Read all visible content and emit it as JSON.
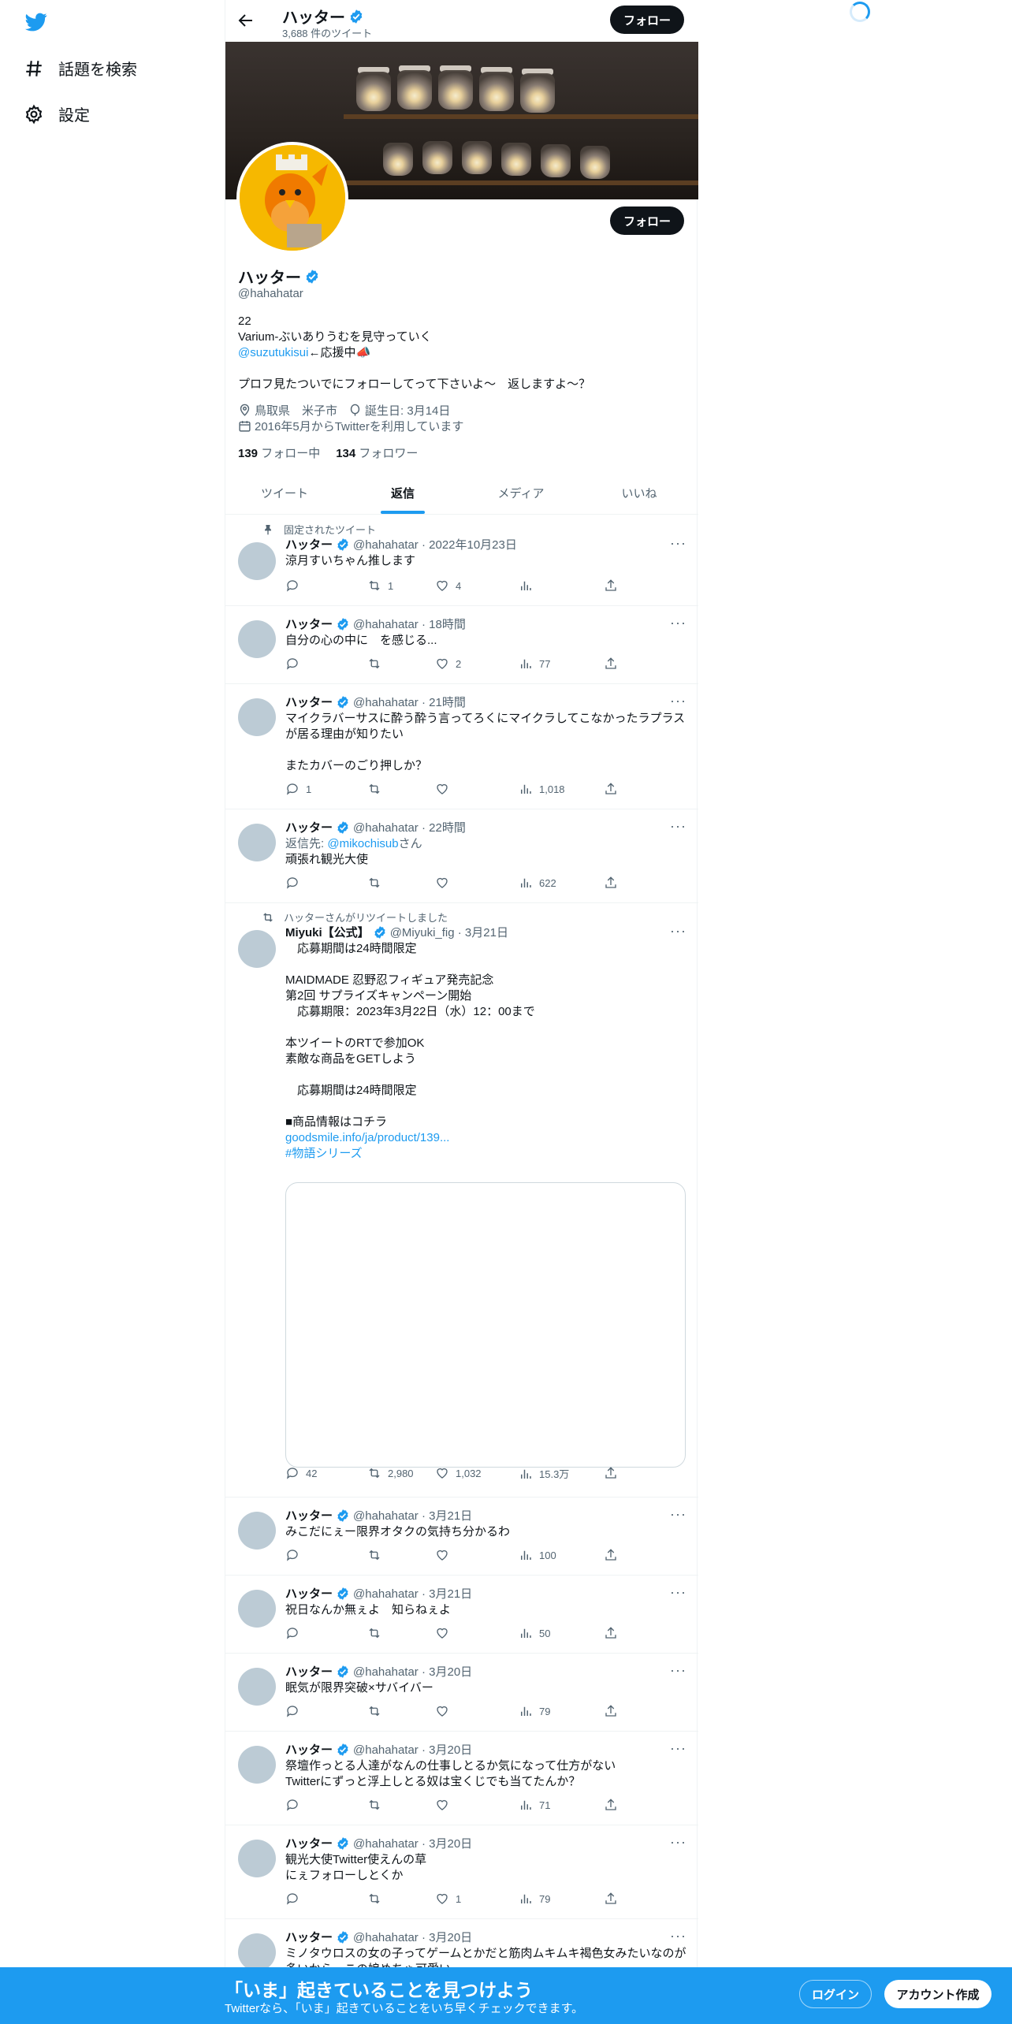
{
  "nav": {
    "items": [
      {
        "label": "話題を検索",
        "icon": "hashtag-icon"
      },
      {
        "label": "設定",
        "icon": "gear-icon"
      }
    ]
  },
  "header": {
    "name": "ハッター",
    "tweet_count": "3,688 件のツイート",
    "follow_label": "フォロー"
  },
  "profile": {
    "name": "ハッター",
    "handle": "@hahahatar",
    "follow_label": "フォロー",
    "bio_line1": "22",
    "bio_line2": "Varium-ぶいありうむを見守っていく",
    "bio_mention": "@suzutukisui",
    "bio_mention_suffix": "←応援中📣",
    "bio_line4": "プロフ見たついでにフォローしてって下さいよ～　返しますよ～？",
    "location": "鳥取県　米子市",
    "birthday": "誕生日: 3月14日",
    "joined": "2016年5月からTwitterを利用しています",
    "following_count": "139",
    "following_label": "フォロー中",
    "followers_count": "134",
    "followers_label": "フォロワー"
  },
  "tabs": [
    {
      "label": "ツイート",
      "active": false
    },
    {
      "label": "返信",
      "active": true
    },
    {
      "label": "メディア",
      "active": false
    },
    {
      "label": "いいね",
      "active": false
    }
  ],
  "tweets": [
    {
      "social": "固定されたツイート",
      "name": "ハッター",
      "handle": "@hahahatar · 2022年10月23日",
      "text": "涼月すいちゃん推します",
      "replies": "",
      "retweets": "1",
      "likes": "4",
      "views": ""
    },
    {
      "name": "ハッター",
      "handle": "@hahahatar · 18時間",
      "text": "自分の心の中に　を感じる...",
      "replies": "",
      "retweets": "",
      "likes": "2",
      "views": "77"
    },
    {
      "name": "ハッター",
      "handle": "@hahahatar · 21時間",
      "text": "マイクラバーサスに酔う酔う言ってろくにマイクラしてこなかったラプラスが居る理由が知りたい\n\nまたカバーのごり押しか？",
      "replies": "1",
      "retweets": "",
      "likes": "",
      "views": "1,018"
    },
    {
      "name": "ハッター",
      "handle": "@hahahatar · 22時間",
      "reply_prefix": "返信先: ",
      "reply_to": "@mikochisub",
      "reply_suffix": "さん",
      "text": "頑張れ観光大使",
      "replies": "",
      "retweets": "",
      "likes": "",
      "views": "622"
    },
    {
      "social": "ハッターさんがリツイートしました",
      "name": "Miyuki【公式】",
      "handle": "@Miyuki_fig · 3月21日",
      "text": "　応募期間は24時間限定\n\nMAIDMADE 忍野忍フィギュア発売記念\n第2回 サプライズキャンペーン開始\n　応募期限：2023年3月22日（水）12：00まで\n\n本ツイートのRTで参加OK\n素敵な商品をGETしよう\n\n　応募期間は24時間限定\n\n■商品情報はコチラ",
      "link": "goodsmile.info/ja/product/139...",
      "hashtag": "#物語シリーズ",
      "replies": "42",
      "retweets": "2,980",
      "likes": "1,032",
      "views": "15.3万"
    },
    {
      "name": "ハッター",
      "handle": "@hahahatar · 3月21日",
      "text": "みこだにぇー限界オタクの気持ち分かるわ",
      "replies": "",
      "retweets": "",
      "likes": "",
      "views": "100"
    },
    {
      "name": "ハッター",
      "handle": "@hahahatar · 3月21日",
      "text": "祝日なんか無ぇよ　知らねぇよ",
      "replies": "",
      "retweets": "",
      "likes": "",
      "views": "50"
    },
    {
      "name": "ハッター",
      "handle": "@hahahatar · 3月20日",
      "text": "眠気が限界突破×サバイバー",
      "replies": "",
      "retweets": "",
      "likes": "",
      "views": "79"
    },
    {
      "name": "ハッター",
      "handle": "@hahahatar · 3月20日",
      "text": "祭壇作っとる人達がなんの仕事しとるか気になって仕方がない\nTwitterにずっと浮上しとる奴は宝くじでも当てたんか？",
      "replies": "",
      "retweets": "",
      "likes": "",
      "views": "71"
    },
    {
      "name": "ハッター",
      "handle": "@hahahatar · 3月20日",
      "text": "観光大使Twitter使えんの草\nにぇフォローしとくか",
      "replies": "",
      "retweets": "",
      "likes": "1",
      "views": "79"
    },
    {
      "name": "ハッター",
      "handle": "@hahahatar · 3月20日",
      "text": "ミノタウロスの女の子ってゲームとかだと筋肉ムキムキ褐色女みたいなのが多いから　この娘めちゃ可愛い",
      "replies": "",
      "retweets": "",
      "likes": "",
      "views": ""
    }
  ],
  "bottom": {
    "title": "「いま」起きていることを見つけよう",
    "subtitle": "Twitterなら、「いま」起きていることをいち早くチェックできます。",
    "login": "ログイン",
    "signup": "アカウント作成"
  },
  "colors": {
    "accent": "#1d9bf0",
    "text": "#0f1419",
    "muted": "#536471",
    "avatar_placeholder": "#bccbd5"
  }
}
